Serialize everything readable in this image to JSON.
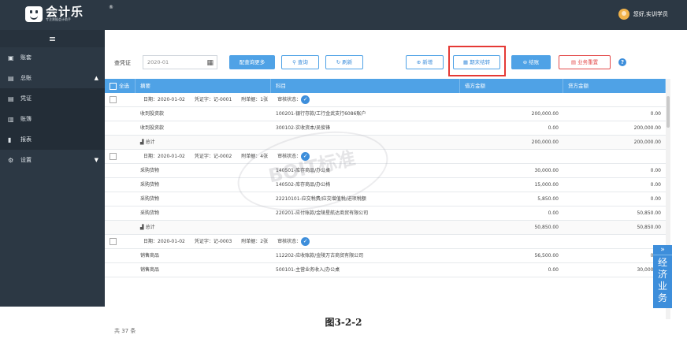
{
  "app": {
    "logo_name": "会计乐",
    "logo_registered": "®",
    "logo_tagline": "专注票据会计助手",
    "user_greeting": "您好,实训学员"
  },
  "sidebar": {
    "menu_toggle": "≡",
    "items": [
      {
        "label": "账套",
        "icon": "ledger-icon"
      },
      {
        "label": "总账",
        "icon": "general-ledger-icon",
        "expanded": true
      },
      {
        "label": "凭证",
        "icon": "voucher-icon"
      },
      {
        "label": "账簿",
        "icon": "book-icon"
      },
      {
        "label": "报表",
        "icon": "report-icon"
      },
      {
        "label": "设置",
        "icon": "settings-icon"
      }
    ]
  },
  "toolbar": {
    "period_label": "查凭证",
    "period_value": "2020-01",
    "more_query": "配查询更多",
    "query": "查询",
    "refresh": "刷新",
    "add": "新增",
    "period_end_transfer": "期末结转",
    "close_account": "结账",
    "business_reset": "业务重置",
    "help": "?"
  },
  "table": {
    "headers": {
      "select_all": "全选",
      "summary": "摘要",
      "account": "科目",
      "debit": "借方金额",
      "credit": "贷方金额"
    },
    "total_label": "总计",
    "vouchers": [
      {
        "meta": "日期：2020-01-02　　凭证字：记-0001　　附单据：1张　　审核状态：",
        "lines": [
          {
            "summary": "收到投资款",
            "account": "100201-银行存款/工行金武支行6086账户",
            "debit": "200,000.00",
            "credit": "0.00"
          },
          {
            "summary": "收到投资款",
            "account": "300102-实收资本/吴俊锋",
            "debit": "0.00",
            "credit": "200,000.00"
          }
        ],
        "total_debit": "200,000.00",
        "total_credit": "200,000.00"
      },
      {
        "meta": "日期：2020-01-02　　凭证字：记-0002　　附单据：4张　　审核状态：",
        "lines": [
          {
            "summary": "采购货物",
            "account": "140501-库存商品/办公桌",
            "debit": "30,000.00",
            "credit": "0.00"
          },
          {
            "summary": "采购货物",
            "account": "140502-库存商品/办公椅",
            "debit": "15,000.00",
            "credit": "0.00"
          },
          {
            "summary": "采购货物",
            "account": "22210101-应交税费/应交增值税/进项税额",
            "debit": "5,850.00",
            "credit": "0.00"
          },
          {
            "summary": "采购货物",
            "account": "220201-应付账款/金陵星航达商贸有限公司",
            "debit": "0.00",
            "credit": "50,850.00"
          }
        ],
        "total_debit": "50,850.00",
        "total_credit": "50,850.00"
      },
      {
        "meta": "日期：2020-01-02　　凭证字：记-0003　　附单据：2张　　审核状态：",
        "lines": [
          {
            "summary": "销售商品",
            "account": "112202-应收账款/金陵万古商贸有限公司",
            "debit": "56,500.00",
            "credit": "0.00"
          },
          {
            "summary": "销售商品",
            "account": "500101-主营业务收入/办公桌",
            "debit": "0.00",
            "credit": "30,000.00"
          }
        ]
      }
    ]
  },
  "footer": {
    "count": "共 37 条"
  },
  "side_widget": {
    "expand": "»",
    "text": "经济业务"
  },
  "watermark": "BOIT标准",
  "caption": "图3-2-2",
  "colors": {
    "primary": "#4fa2e6",
    "sidebar": "#2c3844",
    "highlight": "#e53935",
    "reset": "#e34a4a"
  }
}
